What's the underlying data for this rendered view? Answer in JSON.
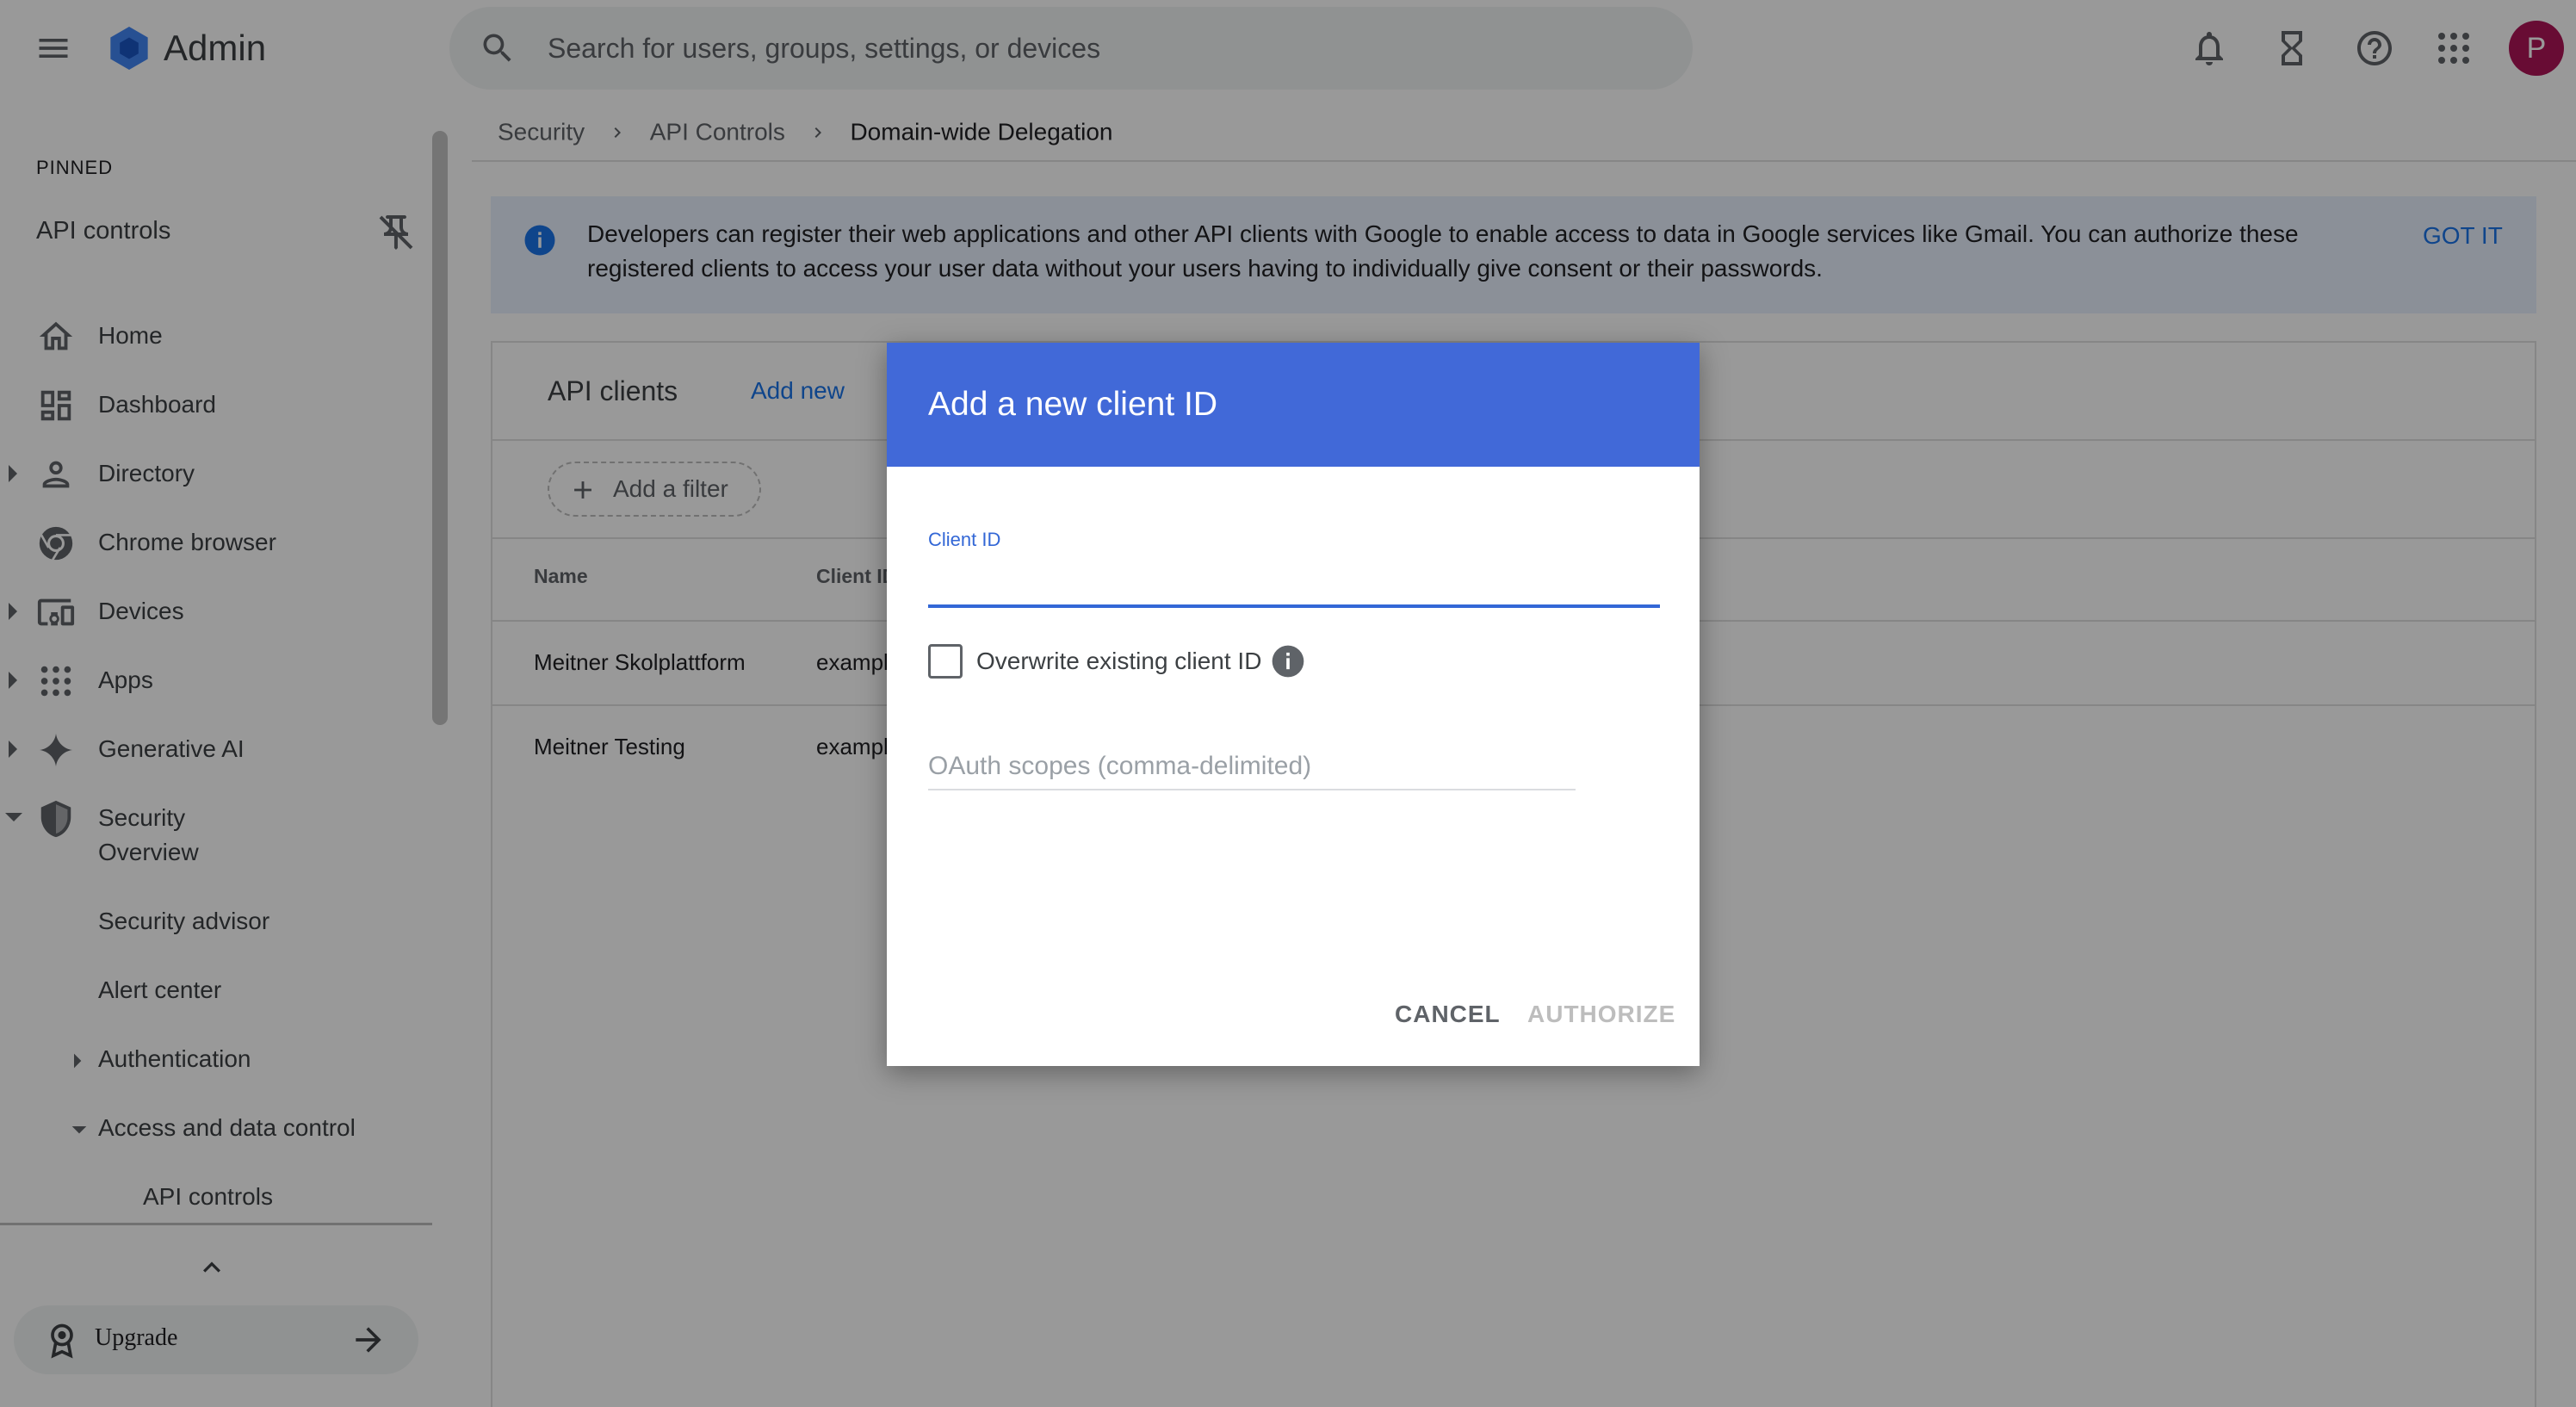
{
  "app": {
    "title": "Admin"
  },
  "search": {
    "placeholder": "Search for users, groups, settings, or devices"
  },
  "avatar": {
    "initial": "P",
    "color": "#ad1457"
  },
  "topbar_icons": [
    "notifications-icon",
    "hourglass-icon",
    "help-icon",
    "apps-grid-icon"
  ],
  "sidebar": {
    "pinned_heading": "PINNED",
    "pinned_item": "API controls",
    "items": [
      {
        "label": "Home",
        "icon": "home-icon",
        "expandable": false
      },
      {
        "label": "Dashboard",
        "icon": "dashboard-icon",
        "expandable": false
      },
      {
        "label": "Directory",
        "icon": "person-icon",
        "expandable": true
      },
      {
        "label": "Chrome browser",
        "icon": "chrome-icon",
        "expandable": false
      },
      {
        "label": "Devices",
        "icon": "devices-icon",
        "expandable": true
      },
      {
        "label": "Apps",
        "icon": "apps-icon",
        "expandable": true
      },
      {
        "label": "Generative AI",
        "icon": "sparkle-icon",
        "expandable": true
      },
      {
        "label": "Security",
        "icon": "shield-icon",
        "expandable": true,
        "expanded": true
      }
    ],
    "security_sub": [
      "Overview",
      "Security advisor",
      "Alert center",
      "Authentication",
      "Access and data control"
    ],
    "access_sub": [
      "API controls"
    ],
    "upgrade_label": "Upgrade"
  },
  "breadcrumb": [
    "Security",
    "API Controls",
    "Domain-wide Delegation"
  ],
  "banner": {
    "text": "Developers can register their web applications and other API clients with Google to enable access to data in Google services like Gmail. You can authorize these registered clients to access your user data without your users having to individually give consent or their passwords.",
    "action": "GOT IT"
  },
  "card": {
    "title": "API clients",
    "add_new": "Add new",
    "filter_label": "Add a filter",
    "columns": [
      "Name",
      "Client ID"
    ],
    "rows": [
      {
        "name": "Meitner Skolplattform",
        "client_id": "exampl"
      },
      {
        "name": "Meitner Testing",
        "client_id": "exampl"
      }
    ]
  },
  "dialog": {
    "title": "Add a new client ID",
    "client_id_label": "Client ID",
    "client_id_value": "",
    "overwrite_label": "Overwrite existing client ID",
    "overwrite_checked": false,
    "scopes_placeholder": "OAuth scopes (comma-delimited)",
    "cancel_label": "CANCEL",
    "authorize_label": "AUTHORIZE"
  },
  "colors": {
    "accent": "#1a73e8",
    "dialog_header": "#4169d8",
    "banner_bg": "#e8f0fe"
  }
}
